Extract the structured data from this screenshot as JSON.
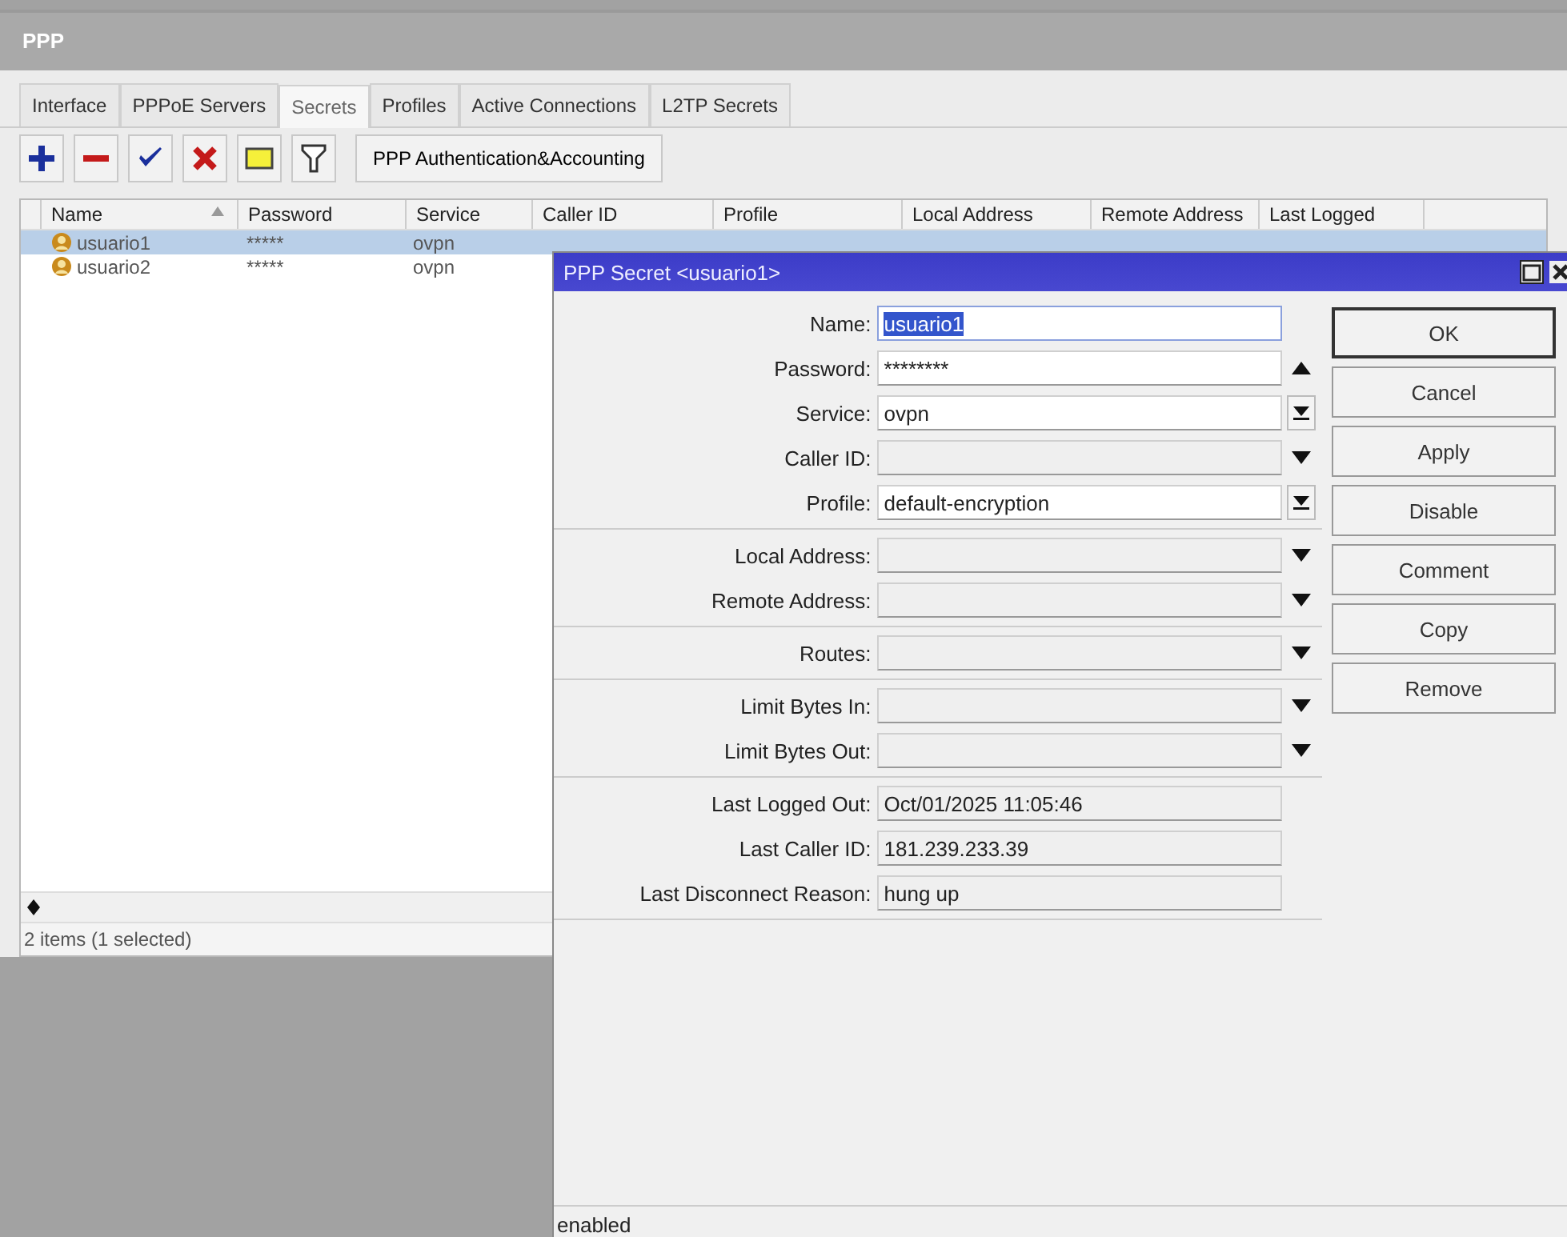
{
  "window": {
    "title": "PPP"
  },
  "tabs": [
    {
      "label": "Interface",
      "selected": false
    },
    {
      "label": "PPPoE Servers",
      "selected": false
    },
    {
      "label": "Secrets",
      "selected": true
    },
    {
      "label": "Profiles",
      "selected": false
    },
    {
      "label": "Active Connections",
      "selected": false
    },
    {
      "label": "L2TP Secrets",
      "selected": false
    }
  ],
  "toolbar": {
    "tools": [
      {
        "kind": "add"
      },
      {
        "kind": "remove"
      },
      {
        "kind": "enable"
      },
      {
        "kind": "disable"
      },
      {
        "kind": "comment"
      },
      {
        "kind": "filter"
      }
    ],
    "button": "PPP Authentication&Accounting"
  },
  "table": {
    "columns": [
      "Name",
      "Password",
      "Service",
      "Caller ID",
      "Profile",
      "Local Address",
      "Remote Address",
      "Last Logged"
    ],
    "rows": [
      {
        "cells": [
          "usuario1",
          "*****",
          "ovpn"
        ],
        "selected": true
      },
      {
        "cells": [
          "usuario2",
          "*****",
          "ovpn"
        ],
        "selected": false
      }
    ],
    "status": "2 items (1 selected)"
  },
  "dialog": {
    "title": "PPP Secret <usuario1>",
    "groups": [
      [
        {
          "label": "Name:",
          "value": "usuario1",
          "kind": "text",
          "highlighted": true
        },
        {
          "label": "Password:",
          "value": "********",
          "kind": "up",
          "highlighted": false
        },
        {
          "label": "Service:",
          "value": "ovpn",
          "kind": "combo",
          "highlighted": false
        },
        {
          "label": "Caller ID:",
          "kind": "down",
          "highlighted": false
        },
        {
          "label": "Profile:",
          "value": "default-encryption",
          "kind": "combo",
          "highlighted": false
        }
      ],
      [
        {
          "label": "Local Address:",
          "kind": "down",
          "highlighted": false
        },
        {
          "label": "Remote Address:",
          "kind": "down",
          "highlighted": false
        }
      ],
      [
        {
          "label": "Routes:",
          "kind": "down",
          "highlighted": false
        }
      ],
      [
        {
          "label": "Limit Bytes In:",
          "kind": "down",
          "highlighted": false
        },
        {
          "label": "Limit Bytes Out:",
          "kind": "down",
          "highlighted": false
        }
      ],
      [
        {
          "label": "Last Logged Out:",
          "value": "Oct/01/2025 11:05:46",
          "kind": "readonly",
          "highlighted": false
        },
        {
          "label": "Last Caller ID:",
          "value": "181.239.233.39",
          "kind": "readonly",
          "highlighted": false
        },
        {
          "label": "Last Disconnect Reason:",
          "value": "hung up",
          "kind": "readonly",
          "highlighted": false
        }
      ]
    ],
    "buttons": [
      {
        "label": "OK",
        "default": true
      },
      {
        "label": "Cancel",
        "default": false
      },
      {
        "label": "Apply",
        "default": false
      },
      {
        "label": "Disable",
        "default": false
      },
      {
        "label": "Comment",
        "default": false
      },
      {
        "label": "Copy",
        "default": false
      },
      {
        "label": "Remove",
        "default": false
      }
    ],
    "status": "enabled"
  }
}
